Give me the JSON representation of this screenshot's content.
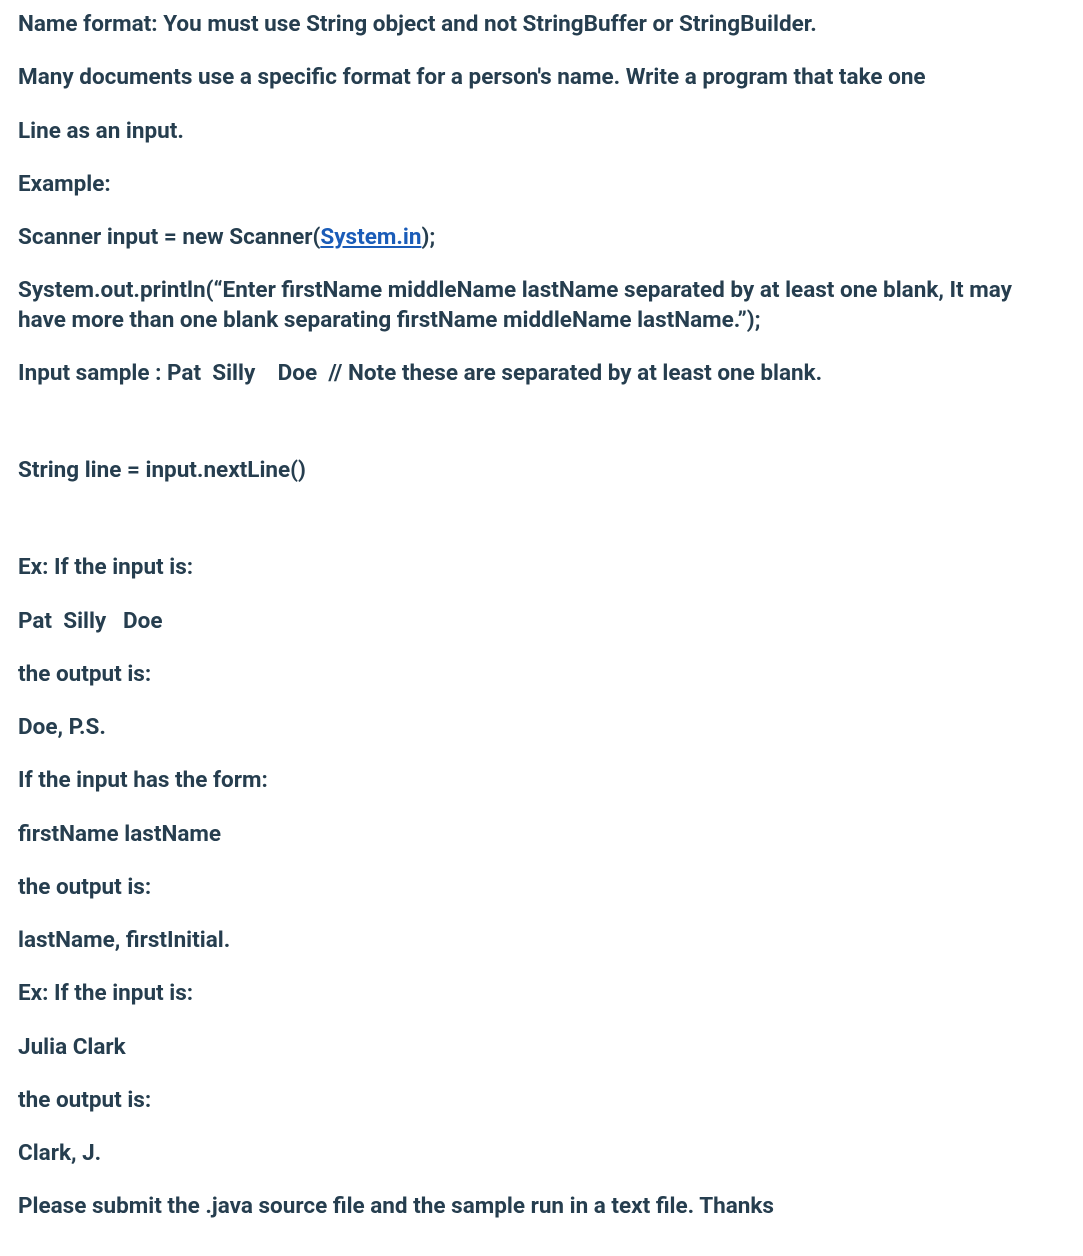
{
  "p1": "Name format: You must use String object and not StringBuffer or StringBuilder.",
  "p2": "Many documents use a specific format for a person's name. Write a program that take one",
  "p3": "Line as an input.",
  "p4": "Example:",
  "p5a": "Scanner input = new Scanner(",
  "p5link": "System.in",
  "p5b": ");",
  "p6": "System.out.println(“Enter firstName middleName lastName separated by at least one blank, It may have more than one blank separating firstName middleName lastName.”);",
  "p7": "Input sample : Pat  Silly    Doe  // Note these are separated by at least one blank.",
  "p8": "String line = input.nextLine()",
  "p9": "Ex: If the input is:",
  "p10": "Pat  Silly   Doe",
  "p11": "the output is:",
  "p12": "Doe, P.S.",
  "p13": "If the input has the form:",
  "p14": "firstName lastName",
  "p15": "the output is:",
  "p16": "lastName, firstInitial.",
  "p17": "Ex: If the input is:",
  "p18": "Julia Clark",
  "p19": "the output is:",
  "p20": "Clark, J.",
  "p21": "Please submit the .java source file and the sample run in a text file.  Thanks"
}
